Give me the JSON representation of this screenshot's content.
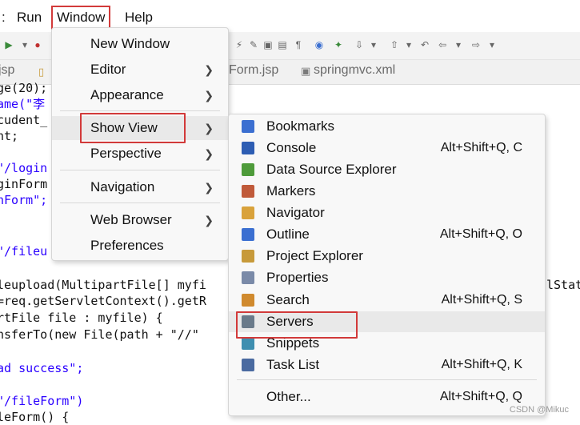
{
  "menubar": {
    "cut_label": ":",
    "run_label": "Run",
    "window_label": "Window",
    "help_label": "Help"
  },
  "tabs": [
    {
      "label": "jsp"
    },
    {
      "label": "Form.jsp"
    },
    {
      "label": "springmvc.xml"
    }
  ],
  "code_lines": [
    "ge(20);",
    "ame(\"李",
    "cudent_",
    "nt;",
    "",
    "\"/login",
    "ginForm",
    "nForm\";",
    "",
    "",
    "\"/fileu",
    "",
    "leupload(MultipartFile[] myfi",
    "=req.getServletContext().getR",
    "rtFile file : myfile) {",
    "nsferTo(new File(path + \"//\"",
    "",
    "ad success\";",
    "",
    "\"/fileForm\")",
    "leForm() {"
  ],
  "code_right_fragment": "lStat",
  "window_menu": {
    "items": [
      {
        "label": "New Window",
        "submenu": false
      },
      {
        "label": "Editor",
        "submenu": true
      },
      {
        "label": "Appearance",
        "submenu": true
      },
      {
        "label": "Show View",
        "submenu": true
      },
      {
        "label": "Perspective",
        "submenu": true
      },
      {
        "label": "Navigation",
        "submenu": true
      },
      {
        "label": "Web Browser",
        "submenu": true
      },
      {
        "label": "Preferences",
        "submenu": false
      }
    ]
  },
  "show_view_menu": {
    "items": [
      {
        "label": "Bookmarks",
        "shortcut": "",
        "icon": "bookmarks-icon",
        "color": "#3b6fd1"
      },
      {
        "label": "Console",
        "shortcut": "Alt+Shift+Q, C",
        "icon": "console-icon",
        "color": "#2d5db3"
      },
      {
        "label": "Data Source Explorer",
        "shortcut": "",
        "icon": "data-source-icon",
        "color": "#4e9b3a"
      },
      {
        "label": "Markers",
        "shortcut": "",
        "icon": "markers-icon",
        "color": "#c05a3a"
      },
      {
        "label": "Navigator",
        "shortcut": "",
        "icon": "navigator-icon",
        "color": "#d9a23b"
      },
      {
        "label": "Outline",
        "shortcut": "Alt+Shift+Q, O",
        "icon": "outline-icon",
        "color": "#3b6fd1"
      },
      {
        "label": "Project Explorer",
        "shortcut": "",
        "icon": "project-explorer-icon",
        "color": "#c79a3a"
      },
      {
        "label": "Properties",
        "shortcut": "",
        "icon": "properties-icon",
        "color": "#7a8aa8"
      },
      {
        "label": "Search",
        "shortcut": "Alt+Shift+Q, S",
        "icon": "search-icon",
        "color": "#d08a2e"
      },
      {
        "label": "Servers",
        "shortcut": "",
        "icon": "servers-icon",
        "color": "#6a7a8a"
      },
      {
        "label": "Snippets",
        "shortcut": "",
        "icon": "snippets-icon",
        "color": "#3f8fb0"
      },
      {
        "label": "Task List",
        "shortcut": "Alt+Shift+Q, K",
        "icon": "task-list-icon",
        "color": "#4a6aa0"
      },
      {
        "label": "Other...",
        "shortcut": "Alt+Shift+Q, Q",
        "icon": "",
        "color": ""
      }
    ]
  },
  "watermark": "CSDN @Mikuc"
}
